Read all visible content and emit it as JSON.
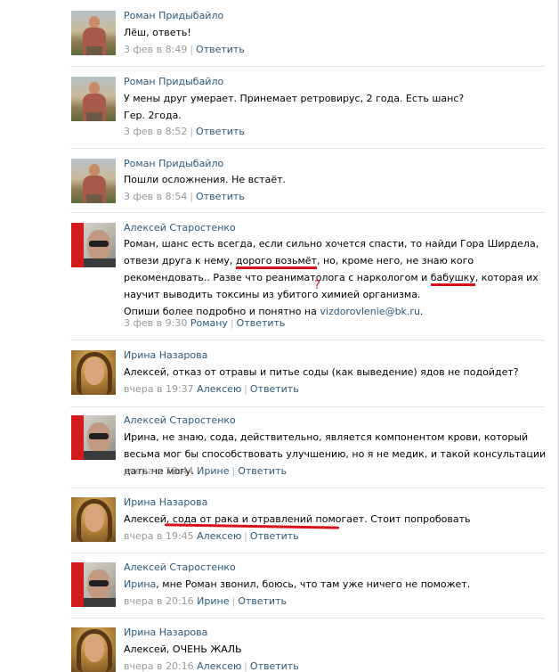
{
  "comments": [
    {
      "author": "Роман Придыбайло",
      "text": "Лёш, ответь!",
      "time": "3 фев в 8:49",
      "reply_to": "",
      "reply_label": "Ответить"
    },
    {
      "author": "Роман Придыбайло",
      "text_lines": [
        "У мены друг умерает. Принемает ретровирус, 2 года. Есть шанс?",
        "Гер. 2года."
      ],
      "time": "3 фев в 8:52",
      "reply_to": "",
      "reply_label": "Ответить"
    },
    {
      "author": "Роман Придыбайло",
      "text": "Пошли осложнения. Не встаёт.",
      "time": "3 фев в 8:54",
      "reply_to": "",
      "reply_label": "Ответить"
    },
    {
      "author": "Алексей Старостенко",
      "text_parts": {
        "p1": "Роман, шанс есть всегда, если сильно хочется спасти, то найди Гора Ширдела, отвези друга к нему, ",
        "mark1": "дорого возьмёт",
        "p2": ", но, кроме него, не знаю кого рекомендовать.. Разве что реаниматолога с наркологом и ",
        "mark2": "бабушку",
        "p3": ", которая их научит выводить токсины из убитого химией организма.",
        "p4": "Опиши более подробно и понятно на ",
        "email": "vizdorovlenie@bk.ru",
        "p5": "."
      },
      "annotation_mark": "?",
      "time": "3 фев в 9:30",
      "reply_to": "Роману",
      "reply_label": "Ответить"
    },
    {
      "author": "Ирина Назарова",
      "text": "Алексей, отказ от отравы и питье соды (как выведение) ядов не подойдет?",
      "time": "вчера в 19:37",
      "reply_to": "Алексею",
      "reply_label": "Ответить"
    },
    {
      "author": "Алексей Старостенко",
      "text": "Ирина, не знаю, сода, действительно, является компонентом крови, который весьма мог бы способствовать улучшению, но я не медик, и такой консультации дать не могу.",
      "time": "вчера в 19:44",
      "reply_to": "Ирине",
      "reply_label": "Ответить"
    },
    {
      "author": "Ирина Назарова",
      "text": "Алексей, сода от рака и отравлений помогает. Стоит попробовать",
      "time": "вчера в 19:45",
      "reply_to": "Алексею",
      "reply_label": "Ответить"
    },
    {
      "author": "Алексей Старостенко",
      "text_parts": {
        "name_link": "Ирина",
        "rest": ", мне Роман звонил, боюсь, что там уже ничего не поможет."
      },
      "time": "вчера в 20:16",
      "reply_to": "Ирине",
      "reply_label": "Ответить"
    },
    {
      "author": "Ирина Назарова",
      "text": "Алексей, ОЧЕНЬ ЖАЛЬ",
      "time": "вчера в 20:16",
      "reply_to": "Алексею",
      "reply_label": "Ответить"
    }
  ],
  "colors": {
    "link": "#2b587a",
    "meta": "#999999",
    "annotation": "#d8101a",
    "divider": "#dfe3e8"
  }
}
